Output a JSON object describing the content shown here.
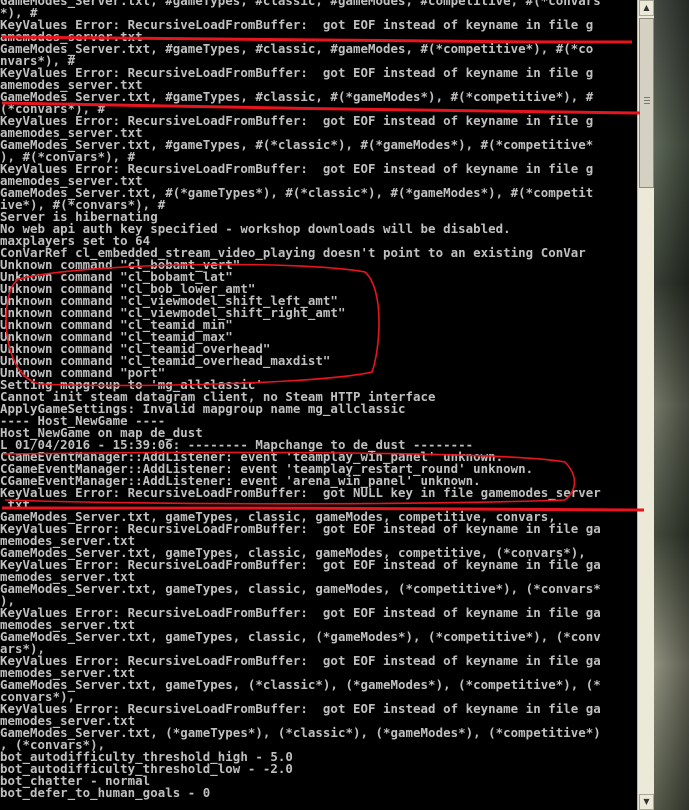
{
  "console": {
    "lines": [
      "GameModes_Server.txt, #gameTypes, #classic, #gameModes, #competitive, #(*convars",
      "*), #",
      "KeyValues Error: RecursiveLoadFromBuffer:  got EOF instead of keyname in file g",
      "amemodes_server.txt",
      "GameModes_Server.txt, #gameTypes, #classic, #gameModes, #(*competitive*), #(*co",
      "nvars*), #",
      "KeyValues Error: RecursiveLoadFromBuffer:  got EOF instead of keyname in file g",
      "amemodes_server.txt",
      "GameModes_Server.txt, #gameTypes, #classic, #(*gameModes*), #(*competitive*), #",
      "(*convars*), #",
      "KeyValues Error: RecursiveLoadFromBuffer:  got EOF instead of keyname in file g",
      "amemodes_server.txt",
      "GameModes_Server.txt, #gameTypes, #(*classic*), #(*gameModes*), #(*competitive*",
      "), #(*convars*), #",
      "KeyValues Error: RecursiveLoadFromBuffer:  got EOF instead of keyname in file g",
      "amemodes_server.txt",
      "GameModes_Server.txt, #(*gameTypes*), #(*classic*), #(*gameModes*), #(*competit",
      "ive*), #(*convars*), #",
      "Server is hibernating",
      "No web api auth key specified - workshop downloads will be disabled.",
      "maxplayers set to 64",
      "ConVarRef cl_embedded_stream_video_playing doesn't point to an existing ConVar",
      "Unknown command \"cl_bobamt_vert\"",
      "Unknown command \"cl_bobamt_lat\"",
      "Unknown command \"cl_bob_lower_amt\"",
      "Unknown command \"cl_viewmodel_shift_left_amt\"",
      "Unknown command \"cl_viewmodel_shift_right_amt\"",
      "Unknown command \"cl_teamid_min\"",
      "Unknown command \"cl_teamid_max\"",
      "Unknown command \"cl_teamid_overhead\"",
      "Unknown command \"cl_teamid_overhead_maxdist\"",
      "Unknown command \"port\"",
      "Setting mapgroup to 'mg_allclassic'",
      "Cannot init steam datagram client, no Steam HTTP interface",
      "ApplyGameSettings: Invalid mapgroup name mg_allclassic",
      "---- Host_NewGame ----",
      "Host_NewGame on map de_dust",
      "L 01/04/2016 - 15:39:06: -------- Mapchange to de_dust --------",
      "CGameEventManager::AddListener: event 'teamplay_win_panel' unknown.",
      "CGameEventManager::AddListener: event 'teamplay_restart_round' unknown.",
      "CGameEventManager::AddListener: event 'arena_win_panel' unknown.",
      "KeyValues Error: RecursiveLoadFromBuffer:  got NULL key in file gamemodes_server",
      ".txt",
      "GameModes_Server.txt, gameTypes, classic, gameModes, competitive, convars,",
      "KeyValues Error: RecursiveLoadFromBuffer:  got EOF instead of keyname in file ga",
      "memodes_server.txt",
      "GameModes_Server.txt, gameTypes, classic, gameModes, competitive, (*convars*),",
      "KeyValues Error: RecursiveLoadFromBuffer:  got EOF instead of keyname in file ga",
      "memodes_server.txt",
      "GameModes_Server.txt, gameTypes, classic, gameModes, (*competitive*), (*convars*",
      "),",
      "KeyValues Error: RecursiveLoadFromBuffer:  got EOF instead of keyname in file ga",
      "memodes_server.txt",
      "GameModes_Server.txt, gameTypes, classic, (*gameModes*), (*competitive*), (*conv",
      "ars*),",
      "KeyValues Error: RecursiveLoadFromBuffer:  got EOF instead of keyname in file ga",
      "memodes_server.txt",
      "GameModes_Server.txt, gameTypes, (*classic*), (*gameModes*), (*competitive*), (*",
      "convars*),",
      "KeyValues Error: RecursiveLoadFromBuffer:  got EOF instead of keyname in file ga",
      "memodes_server.txt",
      "GameModes_Server.txt, (*gameTypes*), (*classic*), (*gameModes*), (*competitive*)",
      ", (*convars*),",
      "bot_autodifficulty_threshold_high - 5.0",
      "bot_autodifficulty_threshold_low - -2.0",
      "bot_chatter - normal",
      "bot_defer_to_human_goals - 0"
    ]
  },
  "annotations": {
    "color": "#e8141e"
  },
  "scrollbar": {
    "up_icon": "arrow-up-icon",
    "down_icon": "arrow-down-icon"
  }
}
